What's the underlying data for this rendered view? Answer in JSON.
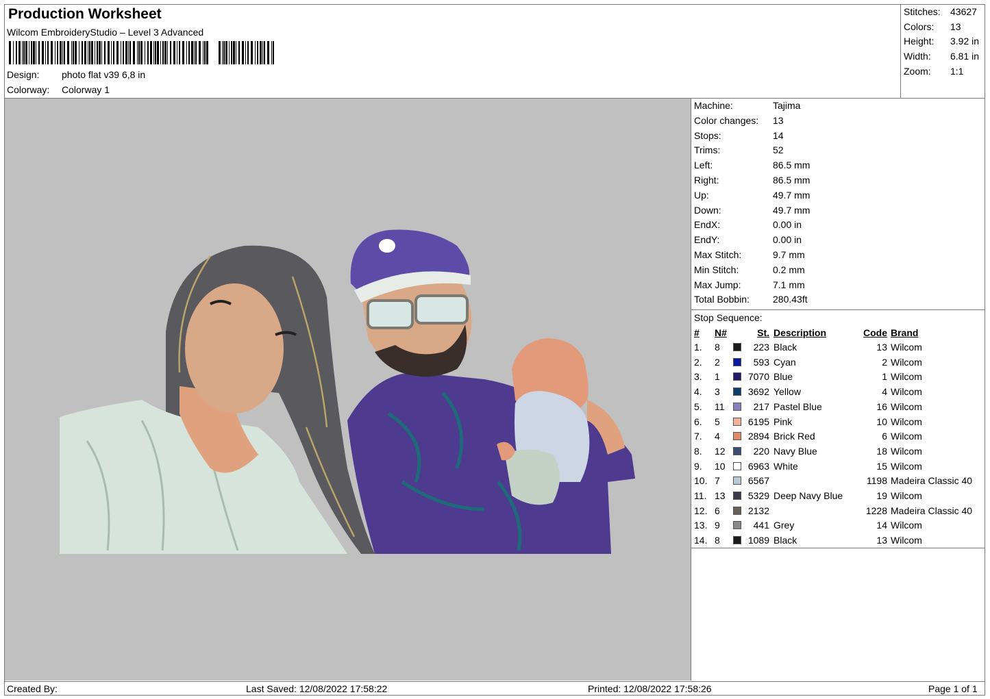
{
  "header": {
    "title": "Production Worksheet",
    "software": "Wilcom EmbroideryStudio – Level 3 Advanced",
    "design_label": "Design:",
    "design_value": "photo flat v39 6,8 in",
    "colorway_label": "Colorway:",
    "colorway_value": "Colorway 1"
  },
  "stats": {
    "stitches_label": "Stitches:",
    "stitches": "43627",
    "colors_label": "Colors:",
    "colors": "13",
    "height_label": "Height:",
    "height": "3.92 in",
    "width_label": "Width:",
    "width": "6.81 in",
    "zoom_label": "Zoom:",
    "zoom": "1:1"
  },
  "machine_info": [
    {
      "label": "Machine:",
      "value": "Tajima"
    },
    {
      "label": "Color changes:",
      "value": "13"
    },
    {
      "label": "Stops:",
      "value": "14"
    },
    {
      "label": "Trims:",
      "value": "52"
    },
    {
      "label": "Left:",
      "value": "86.5 mm"
    },
    {
      "label": "Right:",
      "value": "86.5 mm"
    },
    {
      "label": "Up:",
      "value": "49.7 mm"
    },
    {
      "label": "Down:",
      "value": "49.7 mm"
    },
    {
      "label": "EndX:",
      "value": "0.00 in"
    },
    {
      "label": "EndY:",
      "value": "0.00 in"
    },
    {
      "label": "Max Stitch:",
      "value": "9.7 mm"
    },
    {
      "label": "Min Stitch:",
      "value": "0.2 mm"
    },
    {
      "label": "Max Jump:",
      "value": "7.1 mm"
    },
    {
      "label": "Total Bobbin:",
      "value": "280.43ft"
    }
  ],
  "stop_sequence": {
    "title": "Stop Sequence:",
    "headers": {
      "idx": "#",
      "n": "N#",
      "st": "St.",
      "desc": "Description",
      "code": "Code",
      "brand": "Brand"
    },
    "rows": [
      {
        "idx": "1.",
        "n": "8",
        "color": "#1a1a1a",
        "st": "223",
        "desc": "Black",
        "code": "13",
        "brand": "Wilcom"
      },
      {
        "idx": "2.",
        "n": "2",
        "color": "#0a1aa0",
        "st": "593",
        "desc": "Cyan",
        "code": "2",
        "brand": "Wilcom"
      },
      {
        "idx": "3.",
        "n": "1",
        "color": "#221a6e",
        "st": "7070",
        "desc": "Blue",
        "code": "1",
        "brand": "Wilcom"
      },
      {
        "idx": "4.",
        "n": "3",
        "color": "#0d3f6a",
        "st": "3692",
        "desc": "Yellow",
        "code": "4",
        "brand": "Wilcom"
      },
      {
        "idx": "5.",
        "n": "11",
        "color": "#8a80c0",
        "st": "217",
        "desc": "Pastel Blue",
        "code": "16",
        "brand": "Wilcom"
      },
      {
        "idx": "6.",
        "n": "5",
        "color": "#f2b09a",
        "st": "6195",
        "desc": "Pink",
        "code": "10",
        "brand": "Wilcom"
      },
      {
        "idx": "7.",
        "n": "4",
        "color": "#e08a68",
        "st": "2894",
        "desc": "Brick Red",
        "code": "6",
        "brand": "Wilcom"
      },
      {
        "idx": "8.",
        "n": "12",
        "color": "#3d4a72",
        "st": "220",
        "desc": "Navy Blue",
        "code": "18",
        "brand": "Wilcom"
      },
      {
        "idx": "9.",
        "n": "10",
        "color": "#ffffff",
        "st": "6963",
        "desc": "White",
        "code": "15",
        "brand": "Wilcom"
      },
      {
        "idx": "10.",
        "n": "7",
        "color": "#b8c8d4",
        "st": "6567",
        "desc": "",
        "code": "1198",
        "brand": "Madeira Classic 40"
      },
      {
        "idx": "11.",
        "n": "13",
        "color": "#3a3a4a",
        "st": "5329",
        "desc": "Deep Navy Blue",
        "code": "19",
        "brand": "Wilcom"
      },
      {
        "idx": "12.",
        "n": "6",
        "color": "#6a6058",
        "st": "2132",
        "desc": "",
        "code": "1228",
        "brand": "Madeira Classic 40"
      },
      {
        "idx": "13.",
        "n": "9",
        "color": "#8a8a8a",
        "st": "441",
        "desc": "Grey",
        "code": "14",
        "brand": "Wilcom"
      },
      {
        "idx": "14.",
        "n": "8",
        "color": "#1a1a1a",
        "st": "1089",
        "desc": "Black",
        "code": "13",
        "brand": "Wilcom"
      }
    ]
  },
  "footer": {
    "created_by": "Created By:",
    "last_saved": "Last Saved: 12/08/2022 17:58:22",
    "printed": "Printed: 12/08/2022 17:58:26",
    "page": "Page 1 of 1"
  }
}
